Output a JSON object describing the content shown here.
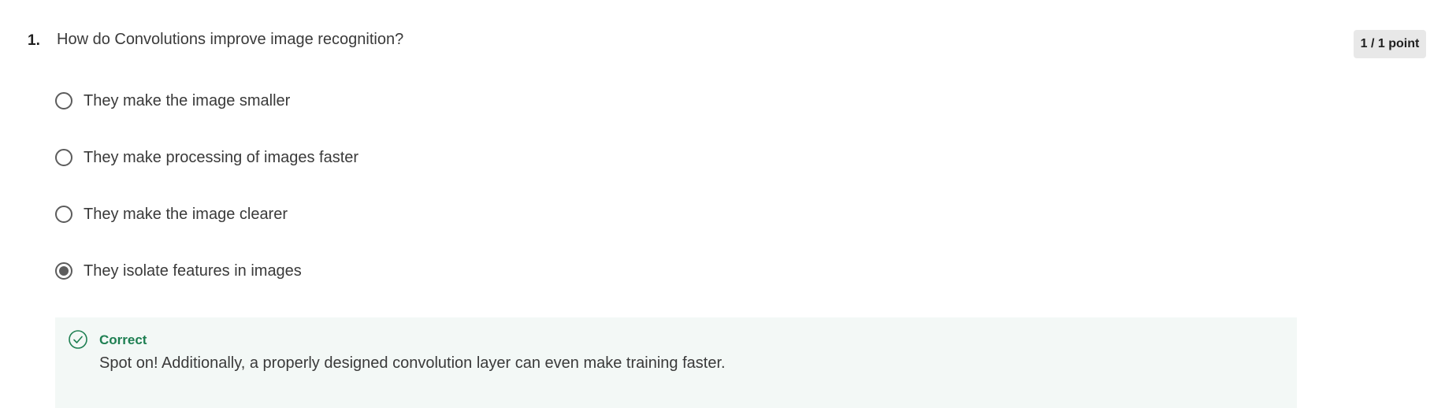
{
  "question": {
    "number": "1.",
    "text": "How do Convolutions improve image recognition?",
    "points": "1 / 1 point"
  },
  "options": [
    {
      "label": "They make the image smaller",
      "selected": false
    },
    {
      "label": "They make processing of images faster",
      "selected": false
    },
    {
      "label": "They make the image clearer",
      "selected": false
    },
    {
      "label": "They isolate features in images",
      "selected": true
    }
  ],
  "feedback": {
    "status": "Correct",
    "message": "Spot on! Additionally, a properly designed convolution layer can even make training faster.",
    "icon": "check-circle-icon",
    "color": "#1e7f52"
  }
}
